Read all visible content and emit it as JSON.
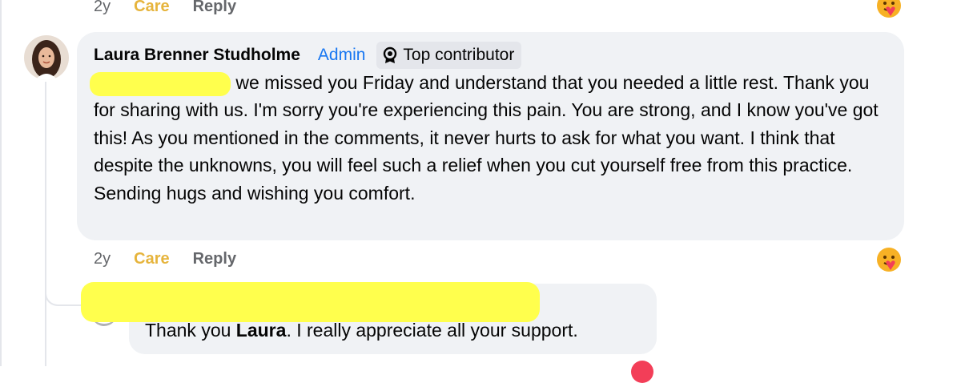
{
  "top_actions": {
    "time": "2y",
    "care_label": "Care",
    "reply_label": "Reply"
  },
  "comment": {
    "author": "Laura Brenner Studholme",
    "admin_badge": "Admin",
    "contributor_badge": "Top contributor",
    "text_line1": "we missed you Friday and understand that you needed a little rest.",
    "text_rest": "Thank you for sharing with us. I'm sorry you're experiencing this pain. You are strong, and I know you've got this! As you mentioned in the comments, it never hurts to ask for what you want. I think that despite the unknowns, you will feel such a relief when you cut yourself free from this practice. Sending hugs and wishing you comfort.",
    "actions": {
      "time": "2y",
      "care_label": "Care",
      "reply_label": "Reply"
    },
    "reaction_icon": "care-emoji-icon"
  },
  "reply": {
    "text_prefix": "Thank you ",
    "text_bold": "Laura",
    "text_suffix": ". I really appreciate all your support."
  },
  "colors": {
    "bubble": "#f0f2f5",
    "care": "#e6b43c",
    "admin": "#1877f2",
    "redaction": "#ffff4d",
    "muted": "#65676b"
  }
}
